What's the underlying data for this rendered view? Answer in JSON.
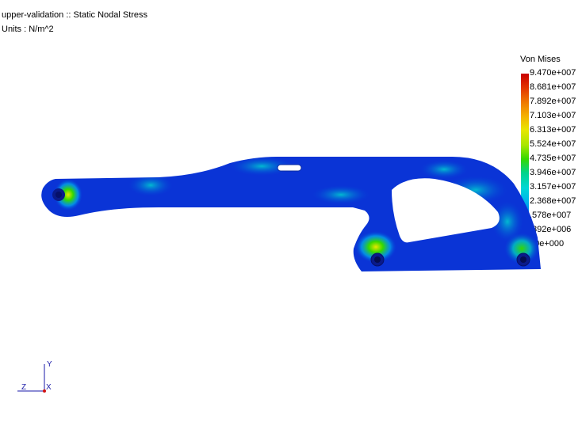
{
  "header": {
    "title": "upper-validation :: Static Nodal Stress",
    "units": "Units : N/m^2"
  },
  "legend": {
    "title": "Von Mises",
    "ticks": [
      "9.470e+007",
      "8.681e+007",
      "7.892e+007",
      "7.103e+007",
      "6.313e+007",
      "5.524e+007",
      "4.735e+007",
      "3.946e+007",
      "3.157e+007",
      "2.368e+007",
      "1.578e+007",
      "7.892e+006",
      "0.000e+000"
    ],
    "visible_ticks": [
      "9.470e+007",
      "8.681e+007",
      "7.892e+007",
      "7.103e+007",
      "6.313e+007",
      "5.524e+007",
      "4.735e+007",
      "3.946e+007",
      "3.157e+007",
      "2.368e+007",
      ".578e+007",
      ".892e+006",
      "00e+000"
    ],
    "colors": {
      "max": "#c80000",
      "mid": "#34d800",
      "min": "#0000c8"
    }
  },
  "triad": {
    "y_label": "Y",
    "z_label": "Z",
    "x_label": "X"
  }
}
